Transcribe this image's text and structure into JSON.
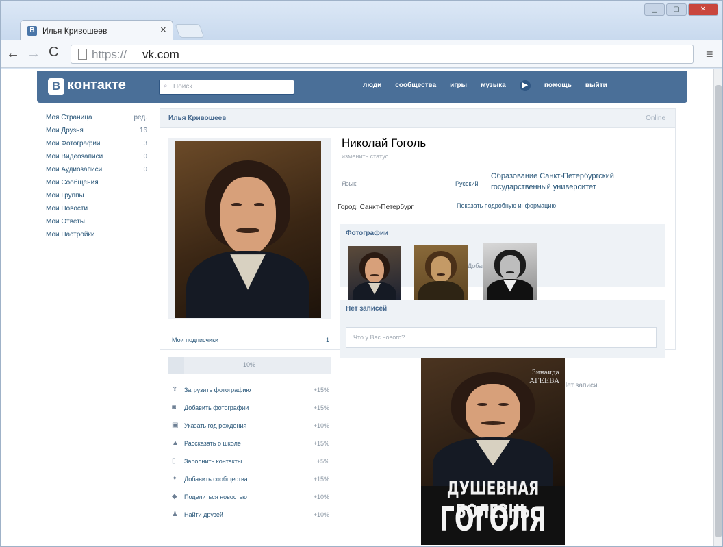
{
  "browser": {
    "tab_title": "Илья Кривошеев",
    "tab_close": "×",
    "url_scheme": "https://",
    "url_host": "vk.com",
    "menu_icon": "≡"
  },
  "vk": {
    "logo_letter": "В",
    "logo_text": "контакте",
    "search_placeholder": "Поиск",
    "nav": [
      "люди",
      "сообщества",
      "игры",
      "музыка",
      "▶",
      "помощь",
      "выйти"
    ]
  },
  "left_menu": [
    {
      "label": "Моя Страница",
      "count": "ред."
    },
    {
      "label": "Мои Друзья",
      "count": "16"
    },
    {
      "label": "Мои Фотографии",
      "count": "3"
    },
    {
      "label": "Мои Видеозаписи",
      "count": "0"
    },
    {
      "label": "Мои Аудиозаписи",
      "count": "0"
    },
    {
      "label": "Мои Сообщения",
      "count": ""
    },
    {
      "label": "Мои Группы",
      "count": ""
    },
    {
      "label": "Мои Новости",
      "count": ""
    },
    {
      "label": "Мои Ответы",
      "count": ""
    },
    {
      "label": "Мои Настройки",
      "count": ""
    }
  ],
  "page_header": {
    "name": "Илья Кривошеев",
    "status": "Online"
  },
  "profile": {
    "name": "Николай Гоголь",
    "status_link": "изменить статус",
    "info_label": "Язык:",
    "language": "Русский",
    "education_line1": "Образование Санкт-Петербургский",
    "education_line2": "государственный университет",
    "city": "Город: Санкт-Петербург",
    "more_info": "Показать подробную информацию"
  },
  "photos": {
    "title": "Фотографии",
    "ghost_text": "Добавить фотографии"
  },
  "posts": {
    "title": "Нет записей",
    "placeholder": "Что у Вас нового?",
    "empty_text": "Нет записи."
  },
  "sidebar": {
    "subscribers_label": "Мои подписчики",
    "subscribers_count": "1",
    "progress_percent": 10,
    "progress_label": "10%",
    "tasks": [
      {
        "icon": "upload-photo-icon",
        "glyph": "⇪",
        "label": "Загрузить фотографию",
        "pct": "+15%"
      },
      {
        "icon": "camera-icon",
        "glyph": "◙",
        "label": "Добавить фотографии",
        "pct": "+15%"
      },
      {
        "icon": "calendar-icon",
        "glyph": "▣",
        "label": "Указать год рождения",
        "pct": "+10%"
      },
      {
        "icon": "school-icon",
        "glyph": "▲",
        "label": "Рассказать о школе",
        "pct": "+15%"
      },
      {
        "icon": "phone-icon",
        "glyph": "▯",
        "label": "Заполнить контакты",
        "pct": "+5%"
      },
      {
        "icon": "community-icon",
        "glyph": "✦",
        "label": "Добавить сообщества",
        "pct": "+15%"
      },
      {
        "icon": "share-icon",
        "glyph": "◆",
        "label": "Поделиться новостью",
        "pct": "+10%"
      },
      {
        "icon": "friends-icon",
        "glyph": "♟",
        "label": "Найти друзей",
        "pct": "+10%"
      }
    ]
  },
  "book": {
    "author_line1": "Зинаида",
    "author_line2": "АГЕЕВА",
    "title_line1": "ДУШЕВНАЯ БОЛЕЗНЬ",
    "title_line2": "ГОГОЛЯ"
  },
  "colors": {
    "vk_blue": "#4a6f98",
    "link": "#2b587a"
  }
}
